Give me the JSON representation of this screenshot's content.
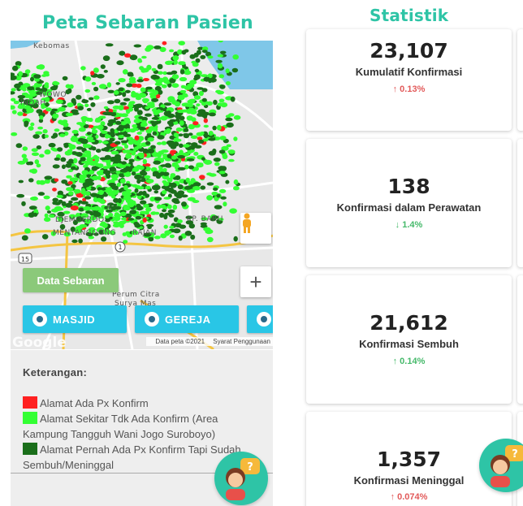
{
  "map_section": {
    "title": "Peta Sebaran Pasien",
    "labels": {
      "kebomas": "Kebomas",
      "wowo": "WOWO",
      "indah": "INDAH",
      "djemoerdo": "DJEMOERDO",
      "menyanggong": "MENYANGGONG",
      "rajan": "RAJAN",
      "kp_baru": "KP. BARU",
      "k": "K",
      "perum": "Perum Citra",
      "surya": "Surya Mas",
      "road15": "15",
      "road1": "1"
    },
    "data_sebaran_button": "Data Sebaran",
    "poi_buttons": [
      "MASJID",
      "GEREJA"
    ],
    "zoom_in": "+",
    "google_logo": "Google",
    "attribution": "Data peta ©2021",
    "terms": "Syarat Penggunaan"
  },
  "legend": {
    "title": "Keterangan:",
    "items": [
      {
        "color": "#ff2020",
        "text": "Alamat Ada Px Konfirm"
      },
      {
        "color": "#33ff33",
        "text": "Alamat Sekitar Tdk Ada Konfirm (Area Kampung Tangguh Wani Jogo Suroboyo)"
      },
      {
        "color": "#1a6e1a",
        "text": "Alamat Pernah Ada Px Konfirm Tapi Sudah Sembuh/Meninggal"
      }
    ]
  },
  "stats_section": {
    "title": "Statistik",
    "cards": [
      {
        "value": "23,107",
        "label": "Kumulatif Konfirmasi",
        "delta": "↑ 0.13%",
        "trend": "up"
      },
      {
        "value": "138",
        "label": "Konfirmasi dalam Perawatan",
        "delta": "↓ 1.4%",
        "trend": "down"
      },
      {
        "value": "21,612",
        "label": "Konfirmasi Sembuh",
        "delta": "↑ 0.14%",
        "trend": "up-green"
      },
      {
        "value": "1,357",
        "label": "Konfirmasi Meninggal",
        "delta": "↑ 0.074%",
        "trend": "up"
      }
    ]
  },
  "colors": {
    "accent": "#2ec4a6",
    "poi_button": "#29c6e6",
    "sebaran_button": "#8bc97a",
    "trend_up": "#e25a5a",
    "trend_down": "#45b96a"
  },
  "icons": {
    "chat": "chat-support-icon",
    "pegman": "pegman-icon",
    "poi": "map-pin-icon"
  }
}
